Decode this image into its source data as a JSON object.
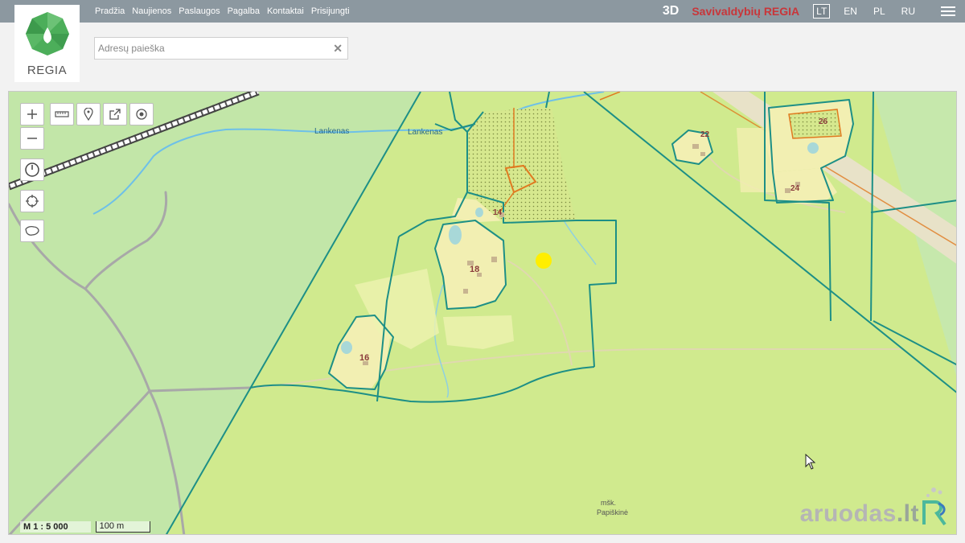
{
  "header": {
    "logo_text": "REGIA",
    "nav": [
      "Pradžia",
      "Naujienos",
      "Paslaugos",
      "Pagalba",
      "Kontaktai",
      "Prisijungti"
    ],
    "btn_3d": "3D",
    "brand": "Savivaldybių REGIA",
    "languages": [
      "LT",
      "EN",
      "PL",
      "RU"
    ],
    "active_language": "LT"
  },
  "search": {
    "placeholder": "Adresų paieška",
    "value": ""
  },
  "map": {
    "labels": {
      "river_west": "Lankenas",
      "river_east": "Lankenas",
      "forest": "mšk.",
      "forest_name": "Papiškinė"
    },
    "parcel_numbers": [
      "16",
      "18",
      "14",
      "22",
      "24",
      "26"
    ],
    "scale_ratio": "M 1 : 5 000",
    "scale_bar": "100 m",
    "colors": {
      "light_green": "#c2e6a8",
      "yellow_green": "#d0ea8e",
      "parcel_yellow": "#f2efb2",
      "boundary": "#1d8f86",
      "road": "#a8a8a8",
      "marker": "#ffee00"
    }
  },
  "tools": {
    "zoom_in_icon": "plus-icon",
    "zoom_out_icon": "minus-icon",
    "measure_icon": "ruler-icon",
    "marker_icon": "pin-icon",
    "share_icon": "share-icon",
    "target_icon": "target-icon",
    "history_icon": "clock-icon",
    "locate_icon": "crosshair-icon",
    "region_icon": "lithuania-outline-icon"
  },
  "watermark": {
    "text": "aruodas",
    "suffix": ".lt"
  }
}
